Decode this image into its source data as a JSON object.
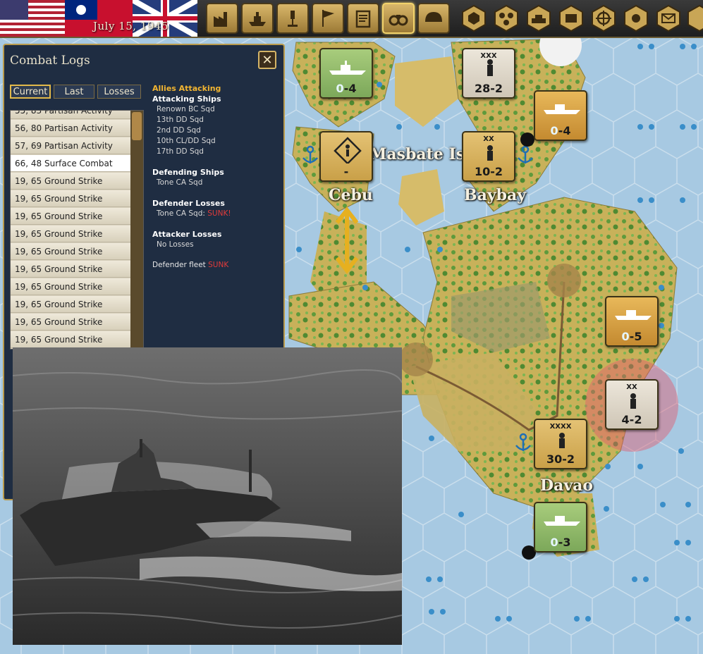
{
  "topbar": {
    "date": "July 15, 1945",
    "buttons": [
      "production",
      "naval",
      "research",
      "diplomacy",
      "reports",
      "intelligence",
      "army"
    ],
    "hex_buttons": [
      "hex-single",
      "hex-group",
      "tank",
      "supply",
      "target",
      "sun",
      "mail",
      "extra"
    ]
  },
  "combat_logs": {
    "title": "Combat Logs",
    "close": "✕",
    "tabs": [
      "Current",
      "Last",
      "Losses"
    ],
    "active_tab": "Current",
    "items": [
      "55, 83 Partisan Activity",
      "56, 80 Partisan Activity",
      "57, 69 Partisan Activity",
      "66, 48 Surface Combat",
      "19, 65 Ground Strike",
      "19, 65 Ground Strike",
      "19, 65 Ground Strike",
      "19, 65 Ground Strike",
      "19, 65 Ground Strike",
      "19, 65 Ground Strike",
      "19, 65 Ground Strike",
      "19, 65 Ground Strike",
      "19, 65 Ground Strike",
      "19, 65 Ground Strike"
    ],
    "selected_index": 3,
    "detail": {
      "attacker": "Allies Attacking",
      "attacking_ships_head": "Attacking Ships",
      "attacking_ships": [
        "Renown BC Sqd",
        "13th DD Sqd",
        "2nd DD Sqd",
        "10th CL/DD Sqd",
        "17th DD Sqd"
      ],
      "defending_ships_head": "Defending Ships",
      "defending_ships": [
        "Tone CA Sqd"
      ],
      "defender_losses_head": "Defender Losses",
      "defender_loss_unit": "Tone CA Sqd:",
      "defender_loss_status": "SUNK!",
      "attacker_losses_head": "Attacker Losses",
      "attacker_losses": "No Losses",
      "defender_fleet_label": "Defender fleet",
      "defender_fleet_status": "SUNK"
    }
  },
  "map": {
    "labels": {
      "cebu": "Cebu",
      "masbate": "Masbate Islan",
      "baybay": "Baybay",
      "davao": "Davao"
    },
    "counters": [
      {
        "id": "us-fleet-north",
        "value_a": "0",
        "value_b": "-4",
        "size": ""
      },
      {
        "id": "army-28",
        "value_a": "28",
        "value_b": "-2",
        "size": "XXX"
      },
      {
        "id": "uk-fleet-north",
        "value_a": "0",
        "value_b": "-4",
        "size": ""
      },
      {
        "id": "cebu-base",
        "value_a": "-",
        "value_b": "",
        "size": ""
      },
      {
        "id": "baybay-div",
        "value_a": "10",
        "value_b": "-2",
        "size": "XX"
      },
      {
        "id": "uk-fleet-east",
        "value_a": "0",
        "value_b": "-5",
        "size": ""
      },
      {
        "id": "enemy-div",
        "value_a": "4",
        "value_b": "-2",
        "size": "XX"
      },
      {
        "id": "davao-army",
        "value_a": "30",
        "value_b": "-2",
        "size": "XXXX"
      },
      {
        "id": "us-fleet-south",
        "value_a": "0",
        "value_b": "-3",
        "size": ""
      }
    ]
  }
}
